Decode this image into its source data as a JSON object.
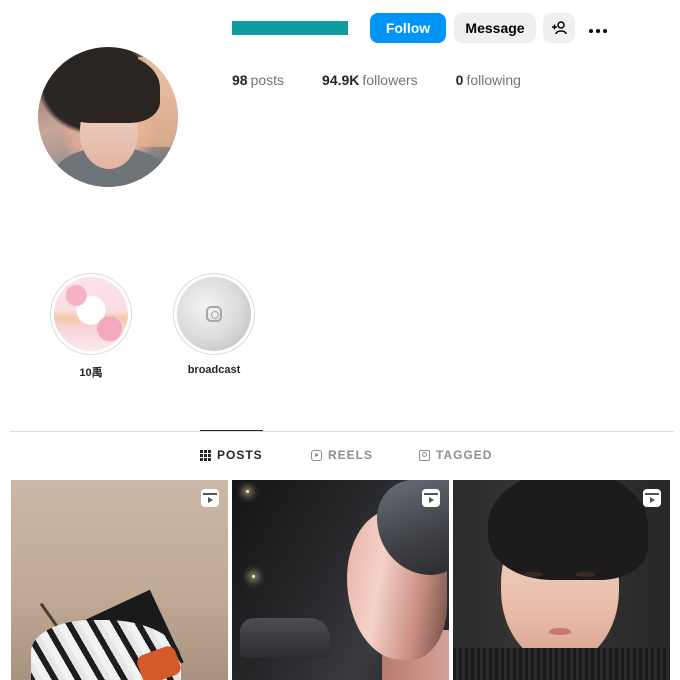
{
  "profile": {
    "username_redacted": true,
    "follow_label": "Follow",
    "message_label": "Message",
    "suggest_icon": "add-person-icon",
    "more_icon": "more-options-icon",
    "stats": {
      "posts_count": "98",
      "posts_label": "posts",
      "followers_count": "94.9K",
      "followers_label": "followers",
      "following_count": "0",
      "following_label": "following"
    }
  },
  "highlights": [
    {
      "label": "10禹"
    },
    {
      "label": "broadcast"
    }
  ],
  "tabs": [
    {
      "label": "POSTS",
      "icon": "grid-icon",
      "active": true
    },
    {
      "label": "REELS",
      "icon": "reels-icon",
      "active": false
    },
    {
      "label": "TAGGED",
      "icon": "tagged-icon",
      "active": false
    }
  ],
  "posts": [
    {
      "type": "reel",
      "badge_icon": "reel-icon"
    },
    {
      "type": "reel",
      "badge_icon": "reel-icon"
    },
    {
      "type": "reel",
      "badge_icon": "reel-icon"
    }
  ],
  "colors": {
    "follow_button": "#0095f6",
    "username_redaction": "#0e9c9e",
    "secondary_button": "#efefef",
    "text_primary": "#262626",
    "text_secondary": "#737373"
  }
}
